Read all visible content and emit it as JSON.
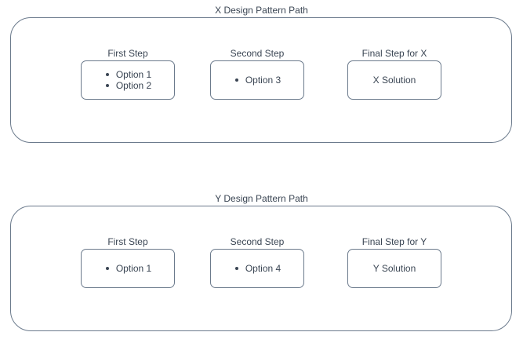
{
  "x_path": {
    "title": "X Design Pattern Path",
    "first_step": {
      "label": "First Step",
      "options": [
        "Option 1",
        "Option 2"
      ]
    },
    "second_step": {
      "label": "Second Step",
      "options": [
        "Option 3"
      ]
    },
    "final_step": {
      "label": "Final Step for X",
      "solution": "X Solution"
    }
  },
  "y_path": {
    "title": "Y Design Pattern Path",
    "first_step": {
      "label": "First Step",
      "options": [
        "Option 1"
      ]
    },
    "second_step": {
      "label": "Second Step",
      "options": [
        "Option 4"
      ]
    },
    "final_step": {
      "label": "Final Step for Y",
      "solution": "Y Solution"
    }
  }
}
